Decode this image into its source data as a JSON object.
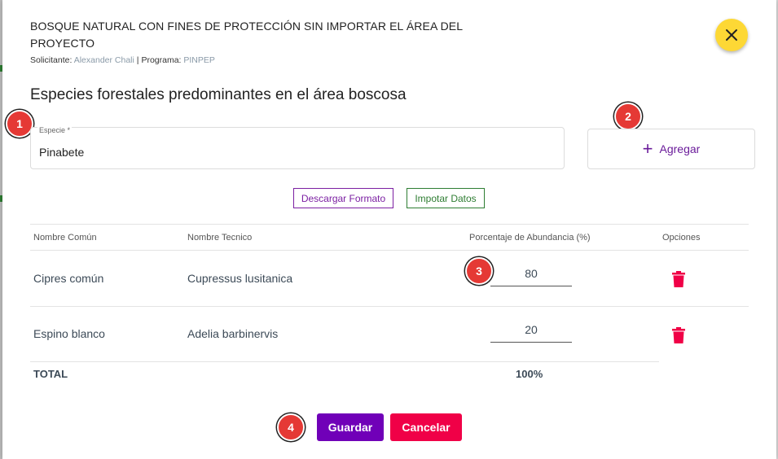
{
  "dialog": {
    "title": "BOSQUE NATURAL CON FINES DE PROTECCIÓN SIN IMPORTAR EL ÁREA DEL PROYECTO",
    "solicitante_label": "Solicitante:",
    "solicitante_value": "Alexander Chali",
    "separator": "|",
    "programa_label": "Programa:",
    "programa_value": "PINPEP",
    "close_icon": "close-icon"
  },
  "section": {
    "title": "Especies forestales predominantes en el área boscosa"
  },
  "species_field": {
    "label": "Especie *",
    "value": "Pinabete"
  },
  "add_button": {
    "label": "Agregar",
    "icon": "plus-icon"
  },
  "actions": {
    "download_label": "Descargar Formato",
    "import_label": "Impotar Datos"
  },
  "steps": [
    "1",
    "2",
    "3",
    "4"
  ],
  "table": {
    "headers": {
      "common": "Nombre Común",
      "technical": "Nombre Tecnico",
      "percent": "Porcentaje de Abundancia (%)",
      "options": "Opciones"
    },
    "rows": [
      {
        "common": "Cipres común",
        "technical": "Cupressus lusitanica",
        "percent": "80"
      },
      {
        "common": "Espino blanco",
        "technical": "Adelia barbinervis",
        "percent": "20"
      }
    ],
    "total_label": "TOTAL",
    "total_value": "100%"
  },
  "footer": {
    "save_label": "Guardar",
    "cancel_label": "Cancelar"
  },
  "colors": {
    "close": "#fdd835",
    "step": "#e53935",
    "primary": "#7000b8",
    "danger": "#f00047",
    "download": "#7b1fa2",
    "import": "#2e7d32"
  }
}
